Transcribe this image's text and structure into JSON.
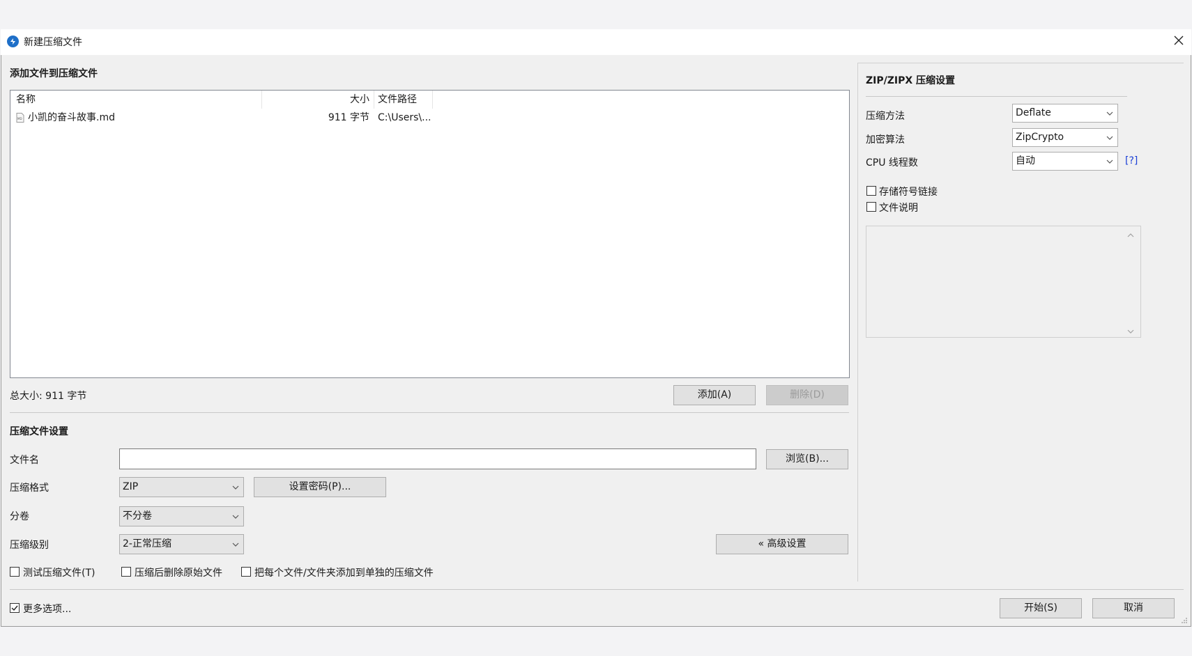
{
  "window": {
    "title": "新建压缩文件"
  },
  "files_section": {
    "title": "添加文件到压缩文件",
    "columns": {
      "name": "名称",
      "size": "大小",
      "path": "文件路径"
    },
    "rows": [
      {
        "name": "小凯的奋斗故事.md",
        "size": "911 字节",
        "path": "C:\\Users\\..."
      }
    ],
    "total_size": "总大小: 911 字节",
    "add_button": "添加(A)",
    "delete_button": "删除(D)"
  },
  "archive_settings": {
    "title": "压缩文件设置",
    "filename_label": "文件名",
    "filename_value": "",
    "browse_button": "浏览(B)...",
    "format_label": "压缩格式",
    "format_value": "ZIP",
    "password_button": "设置密码(P)...",
    "split_label": "分卷",
    "split_value": "不分卷",
    "level_label": "压缩级别",
    "level_value": "2-正常压缩",
    "advanced_button": "« 高级设置",
    "test_archive": {
      "label": "测试压缩文件(T)",
      "checked": false
    },
    "delete_after": {
      "label": "压缩后删除原始文件",
      "checked": false
    },
    "separate_archives": {
      "label": "把每个文件/文件夹添加到单独的压缩文件",
      "checked": false
    }
  },
  "zip_settings": {
    "title": "ZIP/ZIPX 压缩设置",
    "method_label": "压缩方法",
    "method_value": "Deflate",
    "encryption_label": "加密算法",
    "encryption_value": "ZipCrypto",
    "threads_label": "CPU 线程数",
    "threads_value": "自动",
    "help_link": "[?]",
    "store_symlinks": {
      "label": "存储符号链接",
      "checked": false
    },
    "file_comment": {
      "label": "文件说明",
      "checked": false
    },
    "comment_text": ""
  },
  "footer": {
    "more_options": {
      "label": "更多选项...",
      "checked": true
    },
    "start_button": "开始(S)",
    "cancel_button": "取消"
  },
  "icons": {
    "app": "bandizip-app-icon",
    "close": "close-icon",
    "file": "markdown-file-icon",
    "dropdown": "chevron-down-icon"
  }
}
